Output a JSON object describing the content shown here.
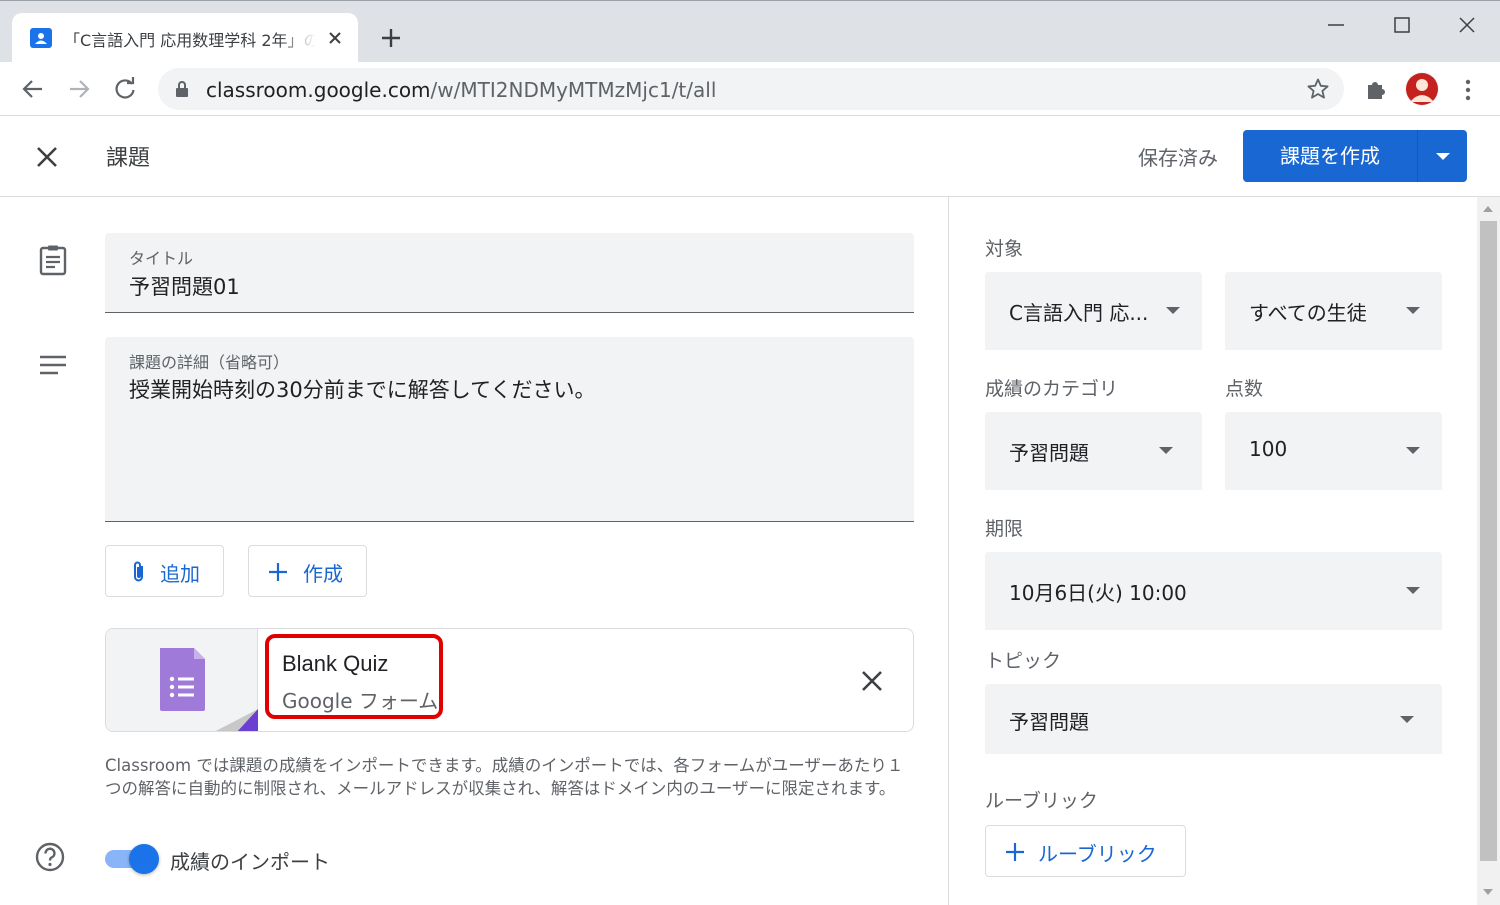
{
  "browser": {
    "tab_title": "「C言語入門 応用数理学科 2年」の",
    "url_domain": "classroom.google.com",
    "url_path": "/w/MTI2NDMyMTMzMjc1/t/all"
  },
  "header": {
    "title": "課題",
    "saved_status": "保存済み",
    "create_button": "課題を作成"
  },
  "form": {
    "title_label": "タイトル",
    "title_value": "予習問題01",
    "details_label": "課題の詳細（省略可）",
    "details_value": "授業開始時刻の30分前までに解答してください。",
    "add_button": "追加",
    "create_button": "作成",
    "attachment": {
      "title": "Blank Quiz",
      "subtitle": "Google フォーム"
    },
    "notice": "Classroom では課題の成績をインポートできます。成績のインポートでは、各フォームがユーザーあたり１つの解答に自動的に制限され、メールアドレスが収集され、解答はドメイン内のユーザーに限定されます。",
    "grade_import_label": "成績のインポート",
    "grade_import_on": true
  },
  "sidebar": {
    "target_label": "対象",
    "class_value": "C言語入門 応...",
    "students_value": "すべての生徒",
    "grade_category_label": "成績のカテゴリ",
    "grade_category_value": "予習問題",
    "points_label": "点数",
    "points_value": "100",
    "due_label": "期限",
    "due_value": "10月6日(火) 10:00",
    "topic_label": "トピック",
    "topic_value": "予習問題",
    "rubric_label": "ルーブリック",
    "rubric_button": "ルーブリック"
  },
  "colors": {
    "primary": "#1967d2",
    "highlight": "#e00000",
    "forms_purple": "#a07ad8"
  }
}
